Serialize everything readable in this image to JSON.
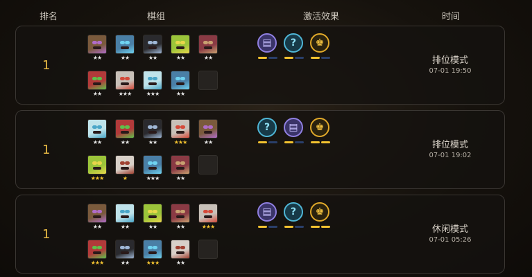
{
  "header": {
    "rank": "排名",
    "team": "棋组",
    "traits": "激活效果",
    "time": "时间"
  },
  "matches": [
    {
      "rank": "1",
      "mode": "排位模式",
      "time": "07-01 19:50",
      "units": [
        {
          "stars": "★★",
          "star_color": "white",
          "face": "#7a5a3c",
          "accent": "#b06cc8"
        },
        {
          "stars": "★★",
          "star_color": "white",
          "face": "#4a7fa6",
          "accent": "#6fd2f0"
        },
        {
          "stars": "★★",
          "star_color": "white",
          "face": "#2a2a2e",
          "accent": "#9fb7d6"
        },
        {
          "stars": "★★",
          "star_color": "white",
          "face": "#9bc43a",
          "accent": "#e8d64a"
        },
        {
          "stars": "★★",
          "star_color": "white",
          "face": "#8a3a44",
          "accent": "#c8a070"
        },
        {
          "stars": "★★",
          "star_color": "white",
          "face": "#b23a3a",
          "accent": "#5fbf4a"
        },
        {
          "stars": "★★★",
          "star_color": "white",
          "face": "#c8c0b8",
          "accent": "#d44a3a"
        },
        {
          "stars": "★★★",
          "star_color": "white",
          "face": "#bfe3ea",
          "accent": "#4aa6c8"
        },
        {
          "stars": "★★",
          "star_color": "white",
          "face": "#4a7fa6",
          "accent": "#6fd2f0"
        },
        {
          "stars": "",
          "star_color": "white",
          "face": "",
          "accent": "",
          "empty": true
        }
      ],
      "traits": [
        {
          "glyph": "▤",
          "border": "#8f7fe0",
          "bg": "#3a3468",
          "fg": "#c8c0ff",
          "bar": [
            "#f2c230",
            "#2a3f6a"
          ]
        },
        {
          "glyph": "?",
          "border": "#4fb6d6",
          "bg": "#173a48",
          "fg": "#8fe0f5",
          "bar": [
            "#f2c230",
            "#2a3f6a"
          ]
        },
        {
          "glyph": "♚",
          "border": "#e0a92a",
          "bg": "#2a220e",
          "fg": "#f0c040",
          "bar": [
            "#f2c230",
            "#2a3f6a"
          ]
        }
      ]
    },
    {
      "rank": "1",
      "mode": "排位模式",
      "time": "07-01 19:02",
      "units": [
        {
          "stars": "★★",
          "star_color": "white",
          "face": "#bfe3ea",
          "accent": "#4aa6c8"
        },
        {
          "stars": "★★",
          "star_color": "white",
          "face": "#b23a3a",
          "accent": "#5fbf4a"
        },
        {
          "stars": "★★",
          "star_color": "white",
          "face": "#2a2a2e",
          "accent": "#9fb7d6"
        },
        {
          "stars": "★★★",
          "star_color": "gold",
          "face": "#c8c0b8",
          "accent": "#d44a3a"
        },
        {
          "stars": "★★",
          "star_color": "white",
          "face": "#7a5a3c",
          "accent": "#b06cc8"
        },
        {
          "stars": "★★★",
          "star_color": "gold",
          "face": "#9bc43a",
          "accent": "#e8d64a"
        },
        {
          "stars": "★",
          "star_color": "gold",
          "face": "#d8d0c8",
          "accent": "#a04030"
        },
        {
          "stars": "★★★",
          "star_color": "white",
          "face": "#4a7fa6",
          "accent": "#6fd2f0"
        },
        {
          "stars": "★★",
          "star_color": "white",
          "face": "#8a3a44",
          "accent": "#c8a070"
        },
        {
          "stars": "",
          "star_color": "white",
          "face": "",
          "accent": "",
          "empty": true
        }
      ],
      "traits": [
        {
          "glyph": "?",
          "border": "#4fb6d6",
          "bg": "#173a48",
          "fg": "#8fe0f5",
          "bar": [
            "#f2c230",
            "#2a3f6a"
          ]
        },
        {
          "glyph": "▤",
          "border": "#8f7fe0",
          "bg": "#3a3468",
          "fg": "#c8c0ff",
          "bar": [
            "#f2c230",
            "#2a3f6a"
          ]
        },
        {
          "glyph": "♚",
          "border": "#e0a92a",
          "bg": "#2a220e",
          "fg": "#f0c040",
          "bar": [
            "#f2c230",
            "#f2c230"
          ]
        }
      ]
    },
    {
      "rank": "1",
      "mode": "休闲模式",
      "time": "07-01 05:26",
      "units": [
        {
          "stars": "★★",
          "star_color": "white",
          "face": "#7a5a3c",
          "accent": "#b06cc8"
        },
        {
          "stars": "★★",
          "star_color": "white",
          "face": "#bfe3ea",
          "accent": "#4aa6c8"
        },
        {
          "stars": "★★",
          "star_color": "white",
          "face": "#9bc43a",
          "accent": "#e8d64a"
        },
        {
          "stars": "★★",
          "star_color": "white",
          "face": "#8a3a44",
          "accent": "#c8a070"
        },
        {
          "stars": "★★★",
          "star_color": "gold",
          "face": "#c8c0b8",
          "accent": "#d44a3a"
        },
        {
          "stars": "★★★",
          "star_color": "gold",
          "face": "#b23a3a",
          "accent": "#5fbf4a"
        },
        {
          "stars": "★★",
          "star_color": "white",
          "face": "#2a2a2e",
          "accent": "#9fb7d6"
        },
        {
          "stars": "★★★",
          "star_color": "gold",
          "face": "#4a7fa6",
          "accent": "#6fd2f0"
        },
        {
          "stars": "★★",
          "star_color": "white",
          "face": "#d8d0c8",
          "accent": "#a04030"
        },
        {
          "stars": "",
          "star_color": "white",
          "face": "",
          "accent": "",
          "empty": true
        }
      ],
      "traits": [
        {
          "glyph": "▤",
          "border": "#8f7fe0",
          "bg": "#3a3468",
          "fg": "#c8c0ff",
          "bar": [
            "#f2c230",
            "#2a3f6a"
          ]
        },
        {
          "glyph": "?",
          "border": "#4fb6d6",
          "bg": "#173a48",
          "fg": "#8fe0f5",
          "bar": [
            "#f2c230",
            "#2a3f6a"
          ]
        },
        {
          "glyph": "♚",
          "border": "#e0a92a",
          "bg": "#2a220e",
          "fg": "#f0c040",
          "bar": [
            "#f2c230",
            "#f2c230"
          ]
        }
      ]
    }
  ]
}
